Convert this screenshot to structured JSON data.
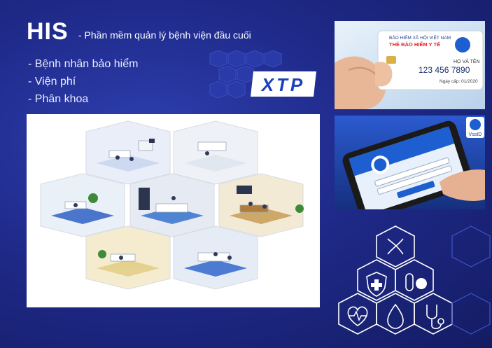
{
  "header": {
    "title": "HIS",
    "subtitle": "- Phần mềm quản lý bệnh viện đầu cuối"
  },
  "features": [
    "- Bệnh nhân bảo hiểm",
    "- Viện phí",
    "- Phân khoa"
  ],
  "logo": {
    "text": "XTP"
  },
  "insurance_card": {
    "issuer": "BẢO HIỂM XÃ HỘI VIỆT NAM",
    "card_type": "THẺ BẢO HIỂM Y TẾ",
    "name_label": "HỌ VÀ TÊN",
    "card_number": "123 456 7890",
    "issue_date": "Ngày cấp: 01/2020"
  },
  "app": {
    "name": "VssID"
  },
  "colors": {
    "background": "#1f2a8a",
    "accent_blue": "#1d5fd0",
    "card_red": "#d8262c"
  },
  "icons": [
    "dna-icon",
    "shield-cross-icon",
    "pill-icon",
    "heart-pulse-icon",
    "drop-icon",
    "stethoscope-icon"
  ]
}
